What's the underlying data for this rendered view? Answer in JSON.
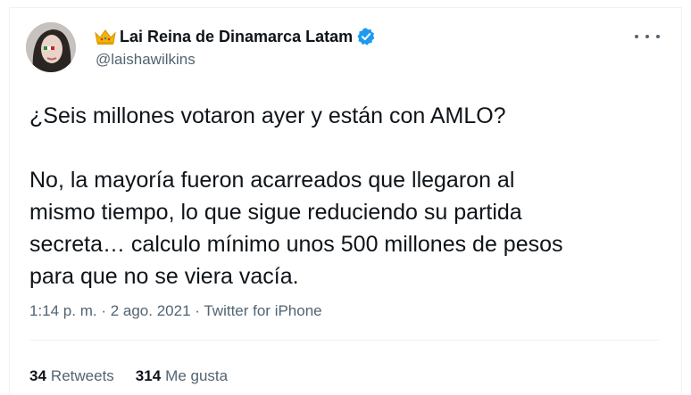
{
  "author": {
    "display_name": "Lai Reina de Dinamarca Latam",
    "handle": "@laishawilkins",
    "name_emoji": "crown-icon",
    "verified_badge": "verified-badge-icon"
  },
  "tweet": {
    "text_line1": "¿Seis millones votaron ayer y están con AMLO?",
    "text_line2": "No, la mayoría fueron acarreados que llegaron al",
    "text_line3": "mismo tiempo, lo que sigue reduciendo su partida",
    "text_line4": "secreta… calculo mínimo unos 500 millones de pesos",
    "text_line5": "para que no se viera vacía.",
    "time": "1:14 p. m.",
    "separator": " · ",
    "date": "2 ago. 2021",
    "source": "Twitter for iPhone"
  },
  "stats": {
    "retweets_count": "34",
    "retweets_label": "Retweets",
    "likes_count": "314",
    "likes_label": "Me gusta"
  },
  "colors": {
    "text": "#0f1419",
    "secondary": "#536471",
    "verified_blue": "#1d9bf0",
    "divider": "#eff3f4"
  }
}
